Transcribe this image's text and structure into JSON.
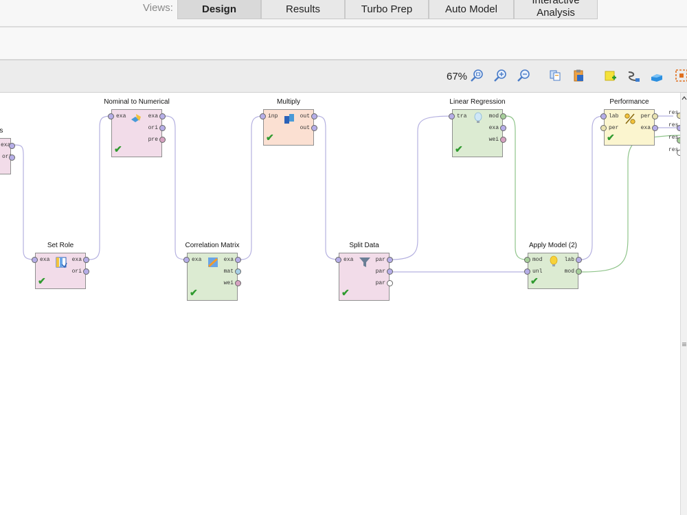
{
  "views": {
    "label": "Views:",
    "tabs": [
      {
        "label": "Design",
        "active": true
      },
      {
        "label": "Results",
        "active": false
      },
      {
        "label": "Turbo Prep",
        "active": false
      },
      {
        "label": "Auto Model",
        "active": false
      },
      {
        "label": "Interactive Analysis",
        "active": false
      }
    ]
  },
  "toolbar": {
    "zoom": "67%",
    "icons": [
      "zoom-fit-icon",
      "zoom-in-icon",
      "zoom-out-icon",
      "copy-icon",
      "paste-icon",
      "add-note-icon",
      "auto-wire-icon",
      "arrange-icon",
      "grid-icon"
    ]
  },
  "operators": {
    "partial": {
      "title": "tes",
      "ports_out": [
        "exa",
        "ori"
      ]
    },
    "nominal": {
      "title": "Nominal to Numerical",
      "ports_in": [
        "exa"
      ],
      "ports_out": [
        "exa",
        "ori",
        "pre"
      ]
    },
    "setrole": {
      "title": "Set Role",
      "ports_in": [
        "exa"
      ],
      "ports_out": [
        "exa",
        "ori"
      ]
    },
    "corr": {
      "title": "Correlation Matrix",
      "ports_in": [
        "exa"
      ],
      "ports_out": [
        "exa",
        "mat",
        "wei"
      ]
    },
    "multiply": {
      "title": "Multiply",
      "ports_in": [
        "inp"
      ],
      "ports_out": [
        "out",
        "out"
      ]
    },
    "split": {
      "title": "Split Data",
      "ports_in": [
        "exa"
      ],
      "ports_out": [
        "par",
        "par",
        "par"
      ]
    },
    "linreg": {
      "title": "Linear Regression",
      "ports_in": [
        "tra"
      ],
      "ports_out": [
        "mod",
        "exa",
        "wei"
      ]
    },
    "apply": {
      "title": "Apply Model (2)",
      "ports_in": [
        "mod",
        "unl"
      ],
      "ports_out": [
        "lab",
        "mod"
      ]
    },
    "perf": {
      "title": "Performance",
      "ports_in": [
        "lab",
        "per"
      ],
      "ports_out": [
        "per",
        "exa"
      ]
    }
  },
  "results": [
    "res",
    "res",
    "res",
    "res"
  ]
}
